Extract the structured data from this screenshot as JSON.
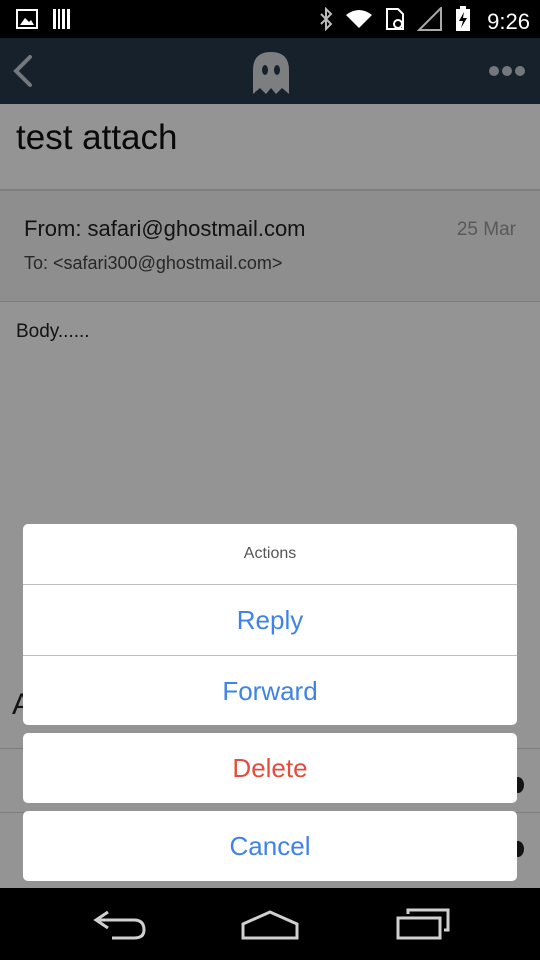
{
  "status_bar": {
    "time": "9:26",
    "left_icons": [
      "image-icon",
      "barcode-icon"
    ],
    "right_icons": [
      "bluetooth-icon",
      "wifi-icon",
      "sim-icon",
      "signal-icon",
      "battery-charging-icon"
    ]
  },
  "app_bar": {
    "background": "#273a4c",
    "back_icon": "chevron-left-icon",
    "logo_icon": "ghost-icon",
    "more_icon": "more-horizontal-icon"
  },
  "email": {
    "subject": "test attach",
    "from": "From: safari@ghostmail.com",
    "to": "To: <safari300@ghostmail.com>",
    "date": "25 Mar",
    "body": "Body......",
    "attachments_label": "A"
  },
  "action_sheet": {
    "title": "Actions",
    "reply_label": "Reply",
    "forward_label": "Forward",
    "delete_label": "Delete",
    "cancel_label": "Cancel",
    "accent_color": "#3f82e8",
    "danger_color": "#e44d3e"
  },
  "nav_bar": {
    "icons": [
      "back-arrow-icon",
      "home-icon",
      "recent-apps-icon"
    ]
  }
}
